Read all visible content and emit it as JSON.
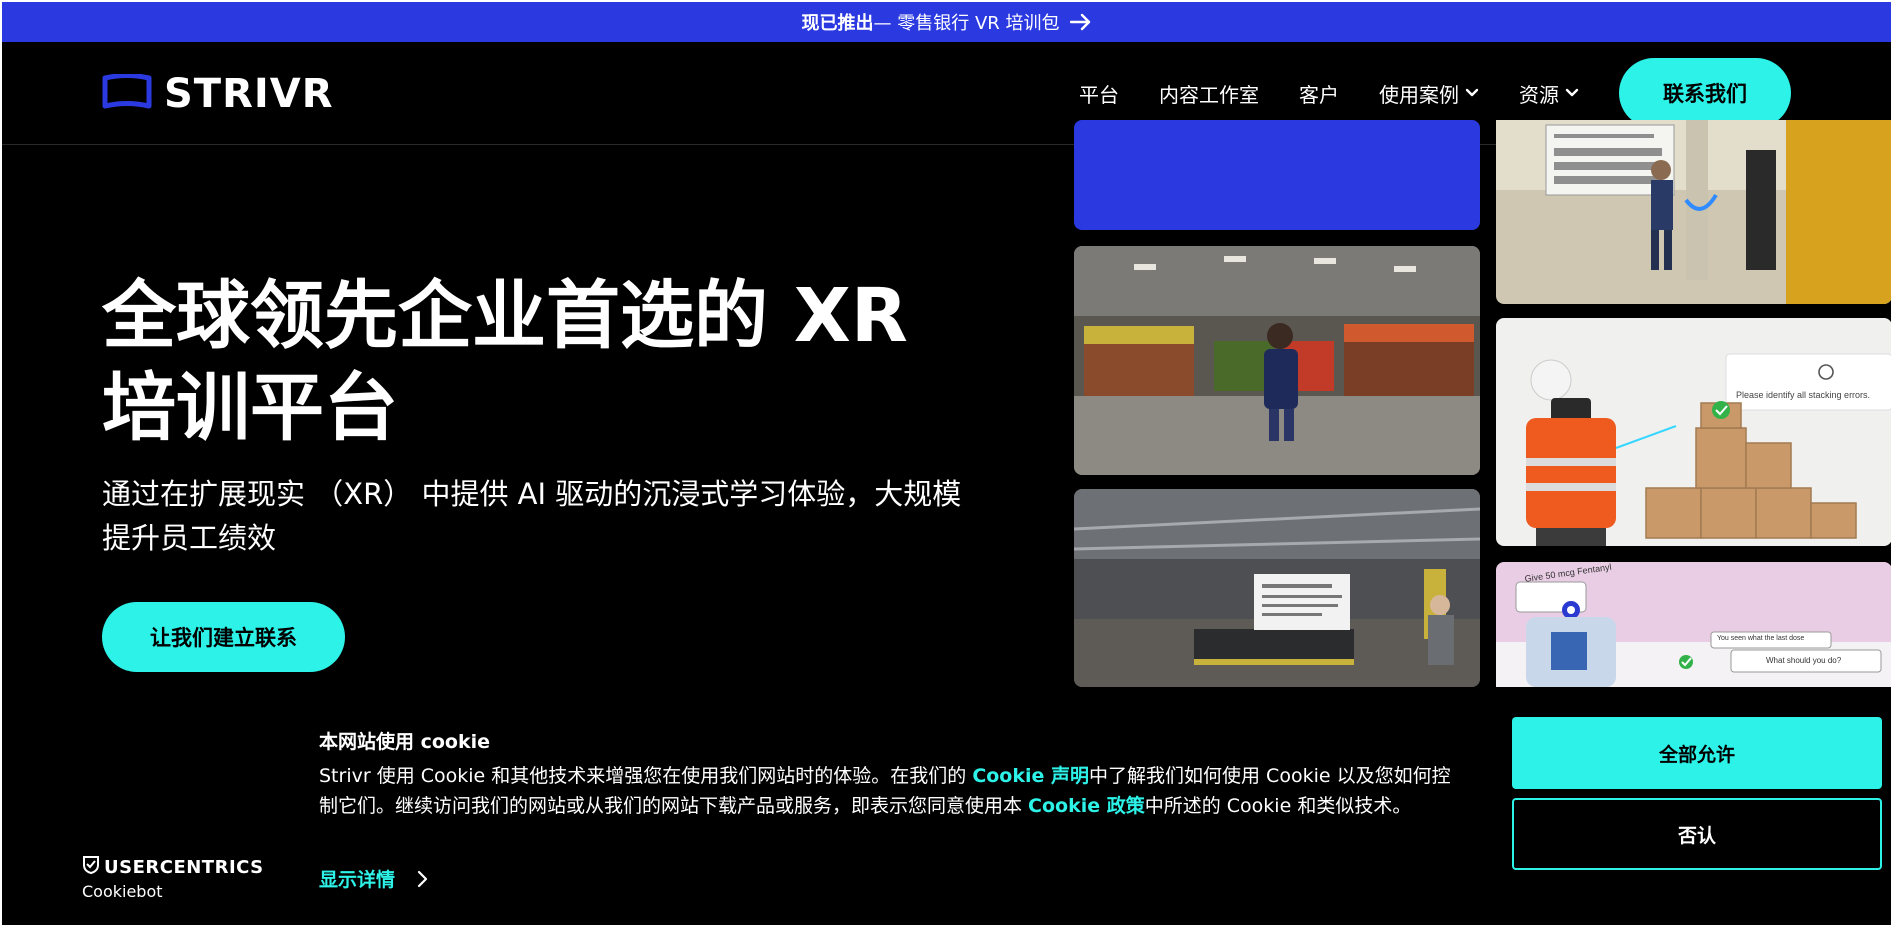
{
  "announcement": {
    "highlight": "现已推出",
    "text": " — 零售银行 VR 培训包"
  },
  "header": {
    "logo_text": "STRIVR",
    "nav": [
      {
        "label": "平台"
      },
      {
        "label": "内容工作室"
      },
      {
        "label": "客户"
      },
      {
        "label": "使用案例"
      },
      {
        "label": "资源"
      }
    ],
    "contact_label": "联系我们"
  },
  "hero": {
    "title": "全球领先企业首选的 XR 培训平台",
    "subtitle": "通过在扩展现实 （XR） 中提供 AI 驱动的沉浸式学习体验，大规模提升员工绩效",
    "cta_label": "让我们建立联系"
  },
  "media": {
    "stacking_prompt": "Please identify all stacking errors.",
    "syringe_label": "Give 50 mcg Fentanyl",
    "dialog_text": "What should you do?",
    "dialog_text2": "You seen what the last dose"
  },
  "cookie": {
    "title": "本网站使用 cookie",
    "text_1": "Strivr 使用 Cookie 和其他技术来增强您在使用我们网站时的体验。在我们的 ",
    "link_1": "Cookie 声明",
    "text_2": "中了解我们如何使用 Cookie 以及您如何控制它们。继续访问我们的网站或从我们的网站下载产品或服务，即表示您同意使用本 ",
    "link_2": "Cookie 政策",
    "text_3": "中所述的 Cookie 和类似技术。",
    "details_label": "显示详情",
    "allow_label": "全部允许",
    "deny_label": "否认",
    "brand_line1": "USERCENTRICS",
    "brand_line2": "Cookiebot"
  },
  "colors": {
    "accent": "#2df2e8",
    "brand_blue": "#2b3ae0",
    "background": "#000000"
  }
}
